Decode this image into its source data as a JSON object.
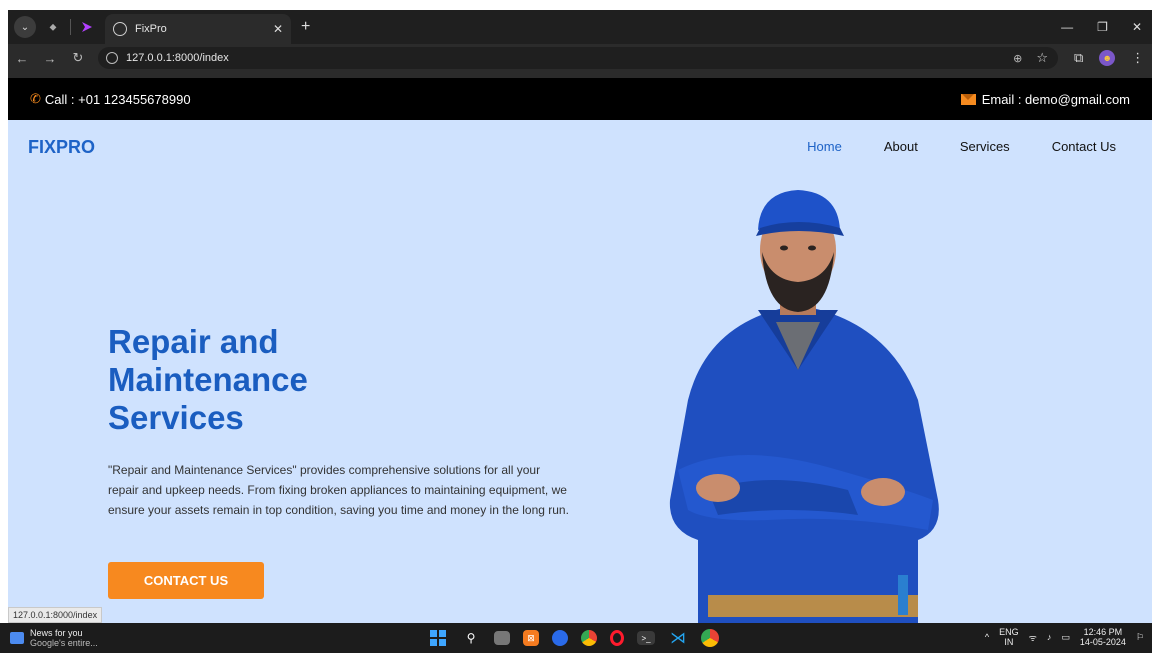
{
  "browser": {
    "tab_title": "FixPro",
    "url": "127.0.0.1:8000/index",
    "status_url": "127.0.0.1:8000/index"
  },
  "topbar": {
    "call": "Call : +01 123455678990",
    "email": "Email : demo@gmail.com"
  },
  "nav": {
    "logo": "FIXPRO",
    "items": [
      "Home",
      "About",
      "Services",
      "Contact Us"
    ],
    "active_index": 0
  },
  "hero": {
    "title_lines": [
      "Repair and",
      "Maintenance",
      "Services"
    ],
    "description": "\"Repair and Maintenance Services\" provides comprehensive solutions for all your repair and upkeep needs. From fixing broken appliances to maintaining equipment, we ensure your assets remain in top condition, saving you time and money in the long run.",
    "cta_label": "CONTACT US"
  },
  "taskbar": {
    "news_title": "News for you",
    "news_sub": "Google's entire...",
    "lang_top": "ENG",
    "lang_bottom": "IN",
    "time": "12:46 PM",
    "date": "14-05-2024"
  },
  "colors": {
    "brand_blue": "#1e63c7",
    "accent_orange": "#f7891f",
    "hero_bg": "#cfe2fe"
  }
}
